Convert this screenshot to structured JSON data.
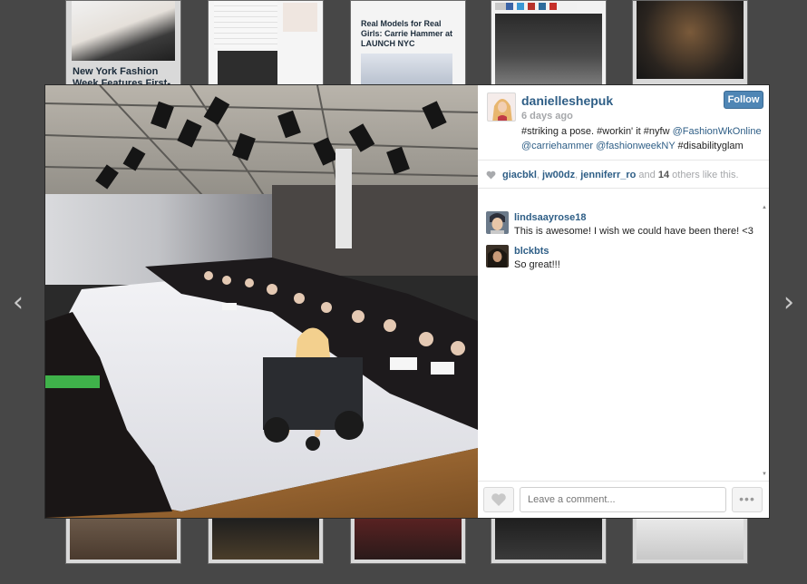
{
  "background": {
    "card1_title": "New York Fashion Week Features First-",
    "card3_title": "Real Models for Real Girls: Carrie Hammer at LAUNCH NYC"
  },
  "post": {
    "username": "danielleshepuk",
    "time_ago": "6 days ago",
    "follow_label": "Follow",
    "caption_text_1": "#striking a pose. #workin' it #nyfw ",
    "caption_mention_1": "@FashionWkOnline",
    "caption_mention_2": "@carriehammer",
    "caption_mention_3": "@fashionweekNY",
    "caption_text_2": " #disabilityglam"
  },
  "likes": {
    "user1": "giacbkl",
    "sep1": ", ",
    "user2": "jw00dz",
    "sep2": ", ",
    "user3": "jenniferr_ro",
    "and_text": " and ",
    "count": "14",
    "suffix": " others like this."
  },
  "comments": [
    {
      "user": "lindsaayrose18",
      "text": "This is awesome! I wish we could have been there! <3"
    },
    {
      "user": "blckbts",
      "text": "So great!!!"
    }
  ],
  "comment_box": {
    "placeholder": "Leave a comment..."
  },
  "more_label": "•••",
  "nav": {
    "prev": "‹",
    "next": "›"
  }
}
